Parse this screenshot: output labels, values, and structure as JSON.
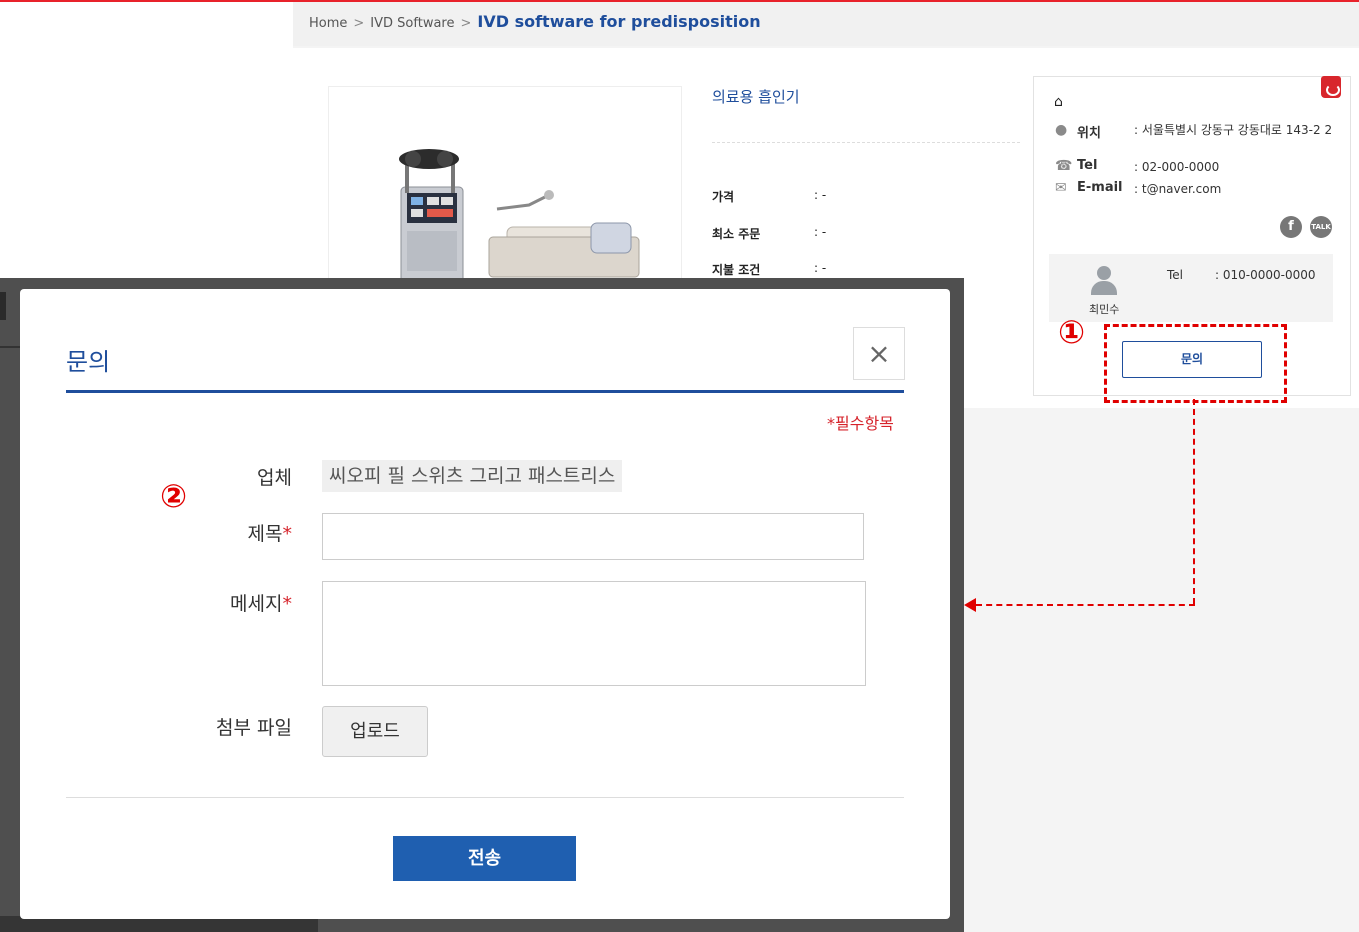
{
  "breadcrumb": {
    "home": "Home",
    "sep": ">",
    "category": "IVD Software",
    "current": "IVD software for predisposition"
  },
  "product": {
    "name": "의료용 흡인기",
    "specs": [
      {
        "label": "가격",
        "value": ": -"
      },
      {
        "label": "최소 주문",
        "value": ": -"
      },
      {
        "label": "지불 조건",
        "value": ": -"
      }
    ]
  },
  "company_card": {
    "address_label": "위치",
    "address": ": 서울특별시 강동구 강동대로 143-2 2",
    "tel_label": "Tel",
    "tel": ": 02-000-0000",
    "email_label": "E-mail",
    "email": ": t@naver.com",
    "social": [
      "facebook-icon",
      "kakaotalk-icon"
    ],
    "talk_text": "TALK",
    "contact": {
      "name": "최민수",
      "tel_label": "Tel",
      "tel": ": 010-0000-0000"
    },
    "inquiry_button": "문의"
  },
  "annotations": {
    "step1": "①",
    "step2": "②",
    "color": "#e00000"
  },
  "modal": {
    "title": "문의",
    "close_icon": "×",
    "required_note": "*필수항목",
    "fields": {
      "company_label": "업체",
      "company_value": "씨오피 필 스위츠 그리고 패스트리스",
      "subject_label": "제목",
      "message_label": "메세지",
      "attachment_label": "첨부 파일",
      "required_mark": "*"
    },
    "upload_button": "업로드",
    "submit_button": "전송"
  },
  "colors": {
    "brand_blue": "#1f4e9c",
    "submit_blue": "#1f5fb0",
    "required_red": "#d6232b",
    "top_accent": "#e8222b"
  }
}
